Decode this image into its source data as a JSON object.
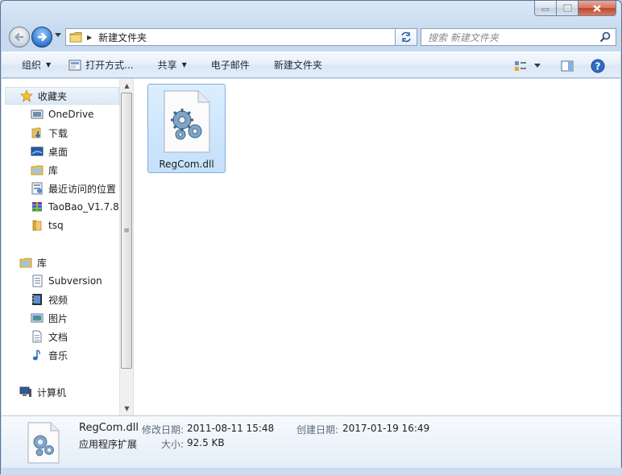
{
  "window": {
    "caption": {
      "minimize": "minimize",
      "maximize": "maximize",
      "close": "close"
    }
  },
  "addressbar": {
    "path": "新建文件夹",
    "search_placeholder": "搜索 新建文件夹"
  },
  "toolbar": {
    "organize": "组织",
    "open_with": "打开方式...",
    "share": "共享",
    "email": "电子邮件",
    "new_folder": "新建文件夹"
  },
  "navigation": {
    "favorites": {
      "label": "收藏夹",
      "items": [
        {
          "label": "OneDrive",
          "icon": "onedrive-icon"
        },
        {
          "label": "下载",
          "icon": "downloads-folder-icon"
        },
        {
          "label": "桌面",
          "icon": "desktop-icon"
        },
        {
          "label": "库",
          "icon": "library-folder-icon"
        },
        {
          "label": "最近访问的位置",
          "icon": "recent-places-icon"
        },
        {
          "label": "TaoBao_V1.7.8.",
          "icon": "archive-icon"
        },
        {
          "label": "tsq",
          "icon": "folder-icon"
        }
      ]
    },
    "libraries": {
      "label": "库",
      "items": [
        {
          "label": "Subversion",
          "icon": "document-library-icon"
        },
        {
          "label": "视频",
          "icon": "video-icon"
        },
        {
          "label": "图片",
          "icon": "pictures-icon"
        },
        {
          "label": "文档",
          "icon": "documents-icon"
        },
        {
          "label": "音乐",
          "icon": "music-icon"
        }
      ]
    },
    "computer": {
      "label": "计算机"
    }
  },
  "files": [
    {
      "name": "RegCom.dll",
      "icon": "dll-gear-file-icon",
      "selected": true
    }
  ],
  "details": {
    "name": "RegCom.dll",
    "type": "应用程序扩展",
    "modified_label": "修改日期:",
    "modified_value": "2011-08-11 15:48",
    "size_label": "大小:",
    "size_value": "92.5 KB",
    "created_label": "创建日期:",
    "created_value": "2017-01-19 16:49"
  },
  "colors": {
    "selection": "#cce4fb",
    "selection_border": "#84acdd",
    "close_button": "#c2442b",
    "forward_button": "#3d83d4"
  }
}
